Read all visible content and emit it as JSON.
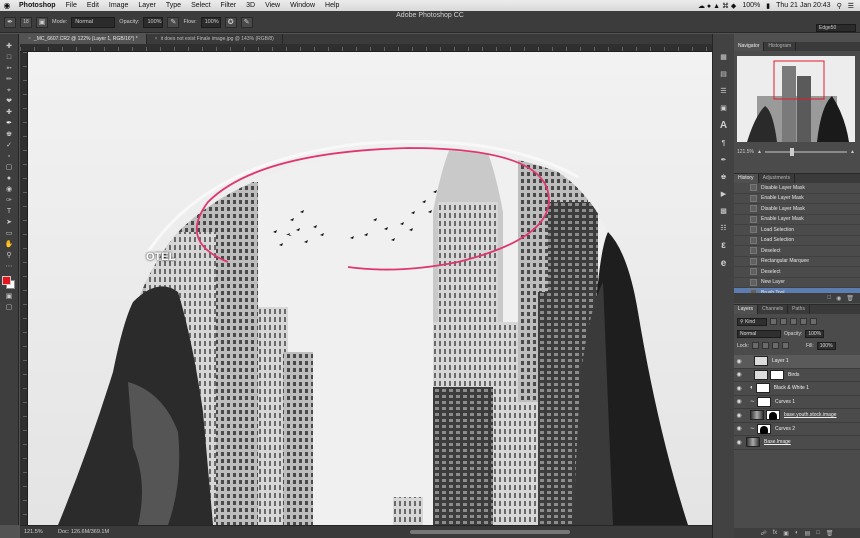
{
  "menubar": {
    "apple": "",
    "items": [
      "Photoshop",
      "File",
      "Edit",
      "Image",
      "Layer",
      "Type",
      "Select",
      "Filter",
      "3D",
      "View",
      "Window",
      "Help"
    ],
    "battery": "100%",
    "datetime": "Thu 21 Jan  20:43"
  },
  "app_title": "Adobe Photoshop CC",
  "options": {
    "mode_label": "Mode:",
    "mode_value": "Normal",
    "opacity_label": "Opacity:",
    "opacity_value": "100%",
    "flow_label": "Flow:",
    "flow_value": "100%",
    "brush_size": "18",
    "workspace": "Edge50"
  },
  "doc_tabs": [
    {
      "label": "_MC_6607.CR2 @ 122% (Layer 1, RGB/16*) *",
      "active": true
    },
    {
      "label": "it does not exist Finale image.jpg @ 143% (RGB/8)",
      "active": false
    }
  ],
  "canvas": {
    "sign_text": "OTEL"
  },
  "status": {
    "zoom": "121.5%",
    "doc": "Doc: 126.6M/369.1M"
  },
  "navigator": {
    "tabs": [
      "Navigator",
      "Histogram"
    ],
    "zoom": "121.5%"
  },
  "history": {
    "tabs": [
      "History",
      "Adjustments"
    ],
    "items": [
      "Disable Layer Mask",
      "Enable Layer Mask",
      "Disable Layer Mask",
      "Enable Layer Mask",
      "Load Selection",
      "Load Selection",
      "Deselect",
      "Rectangular Marquee",
      "Deselect",
      "New Layer",
      "Brush Tool"
    ],
    "selected_index": 10
  },
  "layers": {
    "tabs": [
      "Layers",
      "Channels",
      "Paths"
    ],
    "kind": "Kind",
    "blend": "Normal",
    "opacity_label": "Opacity:",
    "opacity_value": "100%",
    "lock_label": "Lock:",
    "fill_label": "Fill:",
    "fill_value": "100%",
    "items": [
      {
        "name": "Layer 1",
        "selected": true
      },
      {
        "name": "Birds",
        "selected": false
      },
      {
        "name": "Black & White 1",
        "selected": false
      },
      {
        "name": "Curves 1",
        "selected": false
      },
      {
        "name": "base.youth.stock.image",
        "selected": false
      },
      {
        "name": "Curves 2",
        "selected": false
      },
      {
        "name": "Base.Image",
        "selected": false
      }
    ]
  },
  "colors": {
    "foreground": "#e8141c",
    "background": "#ffffff",
    "accent_stroke": "#e0366f",
    "selection": "#5d7cb0"
  }
}
